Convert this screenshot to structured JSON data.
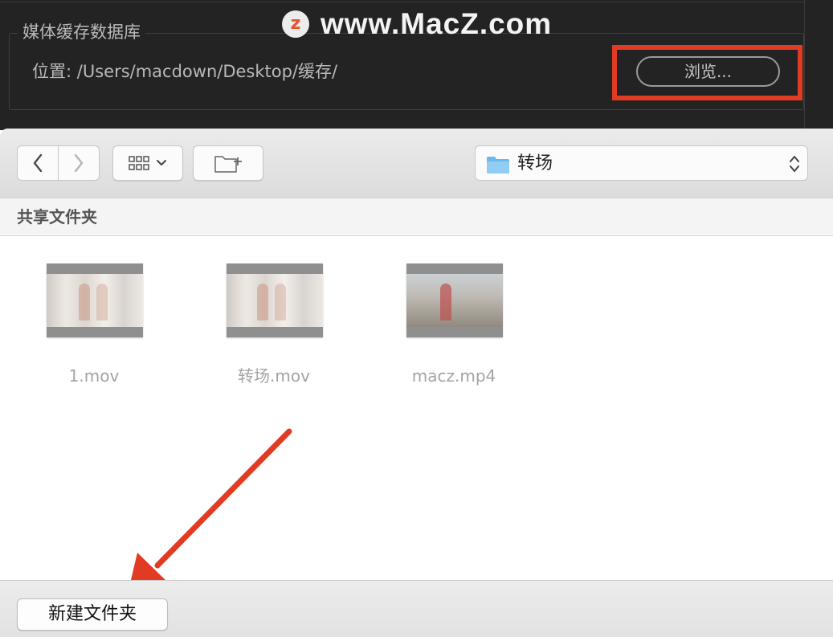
{
  "prefs": {
    "group_title": "媒体缓存数据库",
    "location_label": "位置:",
    "location_path": "/Users/macdown/Desktop/缓存/",
    "browse_label": "浏览..."
  },
  "watermark": {
    "logo_letter": "z",
    "text": "www.MacZ.com"
  },
  "dialog": {
    "current_location": "转场",
    "section_title": "共享文件夹",
    "files": [
      {
        "name": "1.mov"
      },
      {
        "name": "转场.mov"
      },
      {
        "name": "macz.mp4"
      }
    ],
    "new_folder_label": "新建文件夹"
  },
  "colors": {
    "highlight": "#e23b24",
    "folder_blue": "#6bb8ea"
  },
  "icons": {
    "back": "chevron-left-icon",
    "forward": "chevron-right-icon",
    "view": "grid-view-icon",
    "new_folder": "new-folder-icon",
    "location": "folder-icon"
  }
}
